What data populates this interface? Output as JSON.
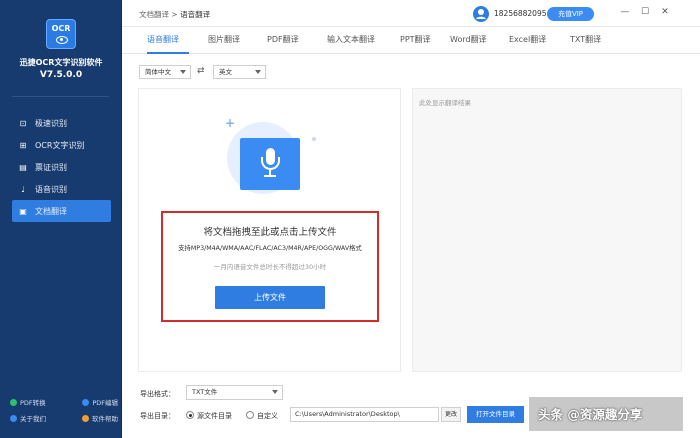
{
  "app": {
    "logo_text": "OCR",
    "name": "迅捷OCR文字识别软件",
    "version": "V7.5.0.0"
  },
  "sidebar": {
    "items": [
      {
        "label": "极速识别",
        "icon": "scan-icon",
        "glyph": "⊡",
        "active": false
      },
      {
        "label": "OCR文字识别",
        "icon": "ocr-icon",
        "glyph": "⊞",
        "active": false
      },
      {
        "label": "票证识别",
        "icon": "ticket-icon",
        "glyph": "▤",
        "active": false
      },
      {
        "label": "语音识别",
        "icon": "mic-icon",
        "glyph": "♩",
        "active": false
      },
      {
        "label": "文档翻译",
        "icon": "translate-icon",
        "glyph": "▣",
        "active": true
      }
    ],
    "bottom_links": [
      {
        "label": "PDF转换",
        "color": "#2fbf71"
      },
      {
        "label": "PDF编辑",
        "color": "#3a8bf2"
      },
      {
        "label": "关于我们",
        "color": "#3a8bf2"
      },
      {
        "label": "软件帮助",
        "color": "#f0a030"
      }
    ]
  },
  "topbar": {
    "breadcrumb_parent": "文档翻译",
    "breadcrumb_sep": ">",
    "breadcrumb_current": "语音翻译",
    "phone": "18256882095",
    "vip_label": "充值VIP",
    "minimize": "—",
    "maximize": "☐",
    "close": "✕"
  },
  "tabs": [
    {
      "label": "语音翻译",
      "active": true
    },
    {
      "label": "图片翻译",
      "active": false
    },
    {
      "label": "PDF翻译",
      "active": false
    },
    {
      "label": "输入文本翻译",
      "active": false
    },
    {
      "label": "PPT翻译",
      "active": false
    },
    {
      "label": "Word翻译",
      "active": false
    },
    {
      "label": "Excel翻译",
      "active": false
    },
    {
      "label": "TXT翻译",
      "active": false
    }
  ],
  "language": {
    "source": "简体中文",
    "target": "英文",
    "swap_glyph": "⇄"
  },
  "upload": {
    "title": "将文档拖拽至此或点击上传文件",
    "formats": "支持MP3/M4A/WMA/AAC/FLAC/AC3/M4R/APE/OGG/WAV格式",
    "limit": "一月内语音文件总时长不得超过30小时",
    "button": "上传文件"
  },
  "result": {
    "placeholder": "此处显示翻译结果"
  },
  "export": {
    "format_label": "导出格式：",
    "format_value": "TXT文件",
    "dir_label": "导出目录：",
    "option_source": "源文件目录",
    "option_custom": "自定义",
    "path": "C:\\Users\\Administrator\\Desktop\\",
    "change_button": "更改",
    "open_dir_button": "打开文件目录"
  },
  "watermark": "头条 @资源趣分享",
  "colors": {
    "sidebar_bg": "#173b6e",
    "accent": "#2f7de1",
    "highlight_border": "#d62b2b"
  }
}
